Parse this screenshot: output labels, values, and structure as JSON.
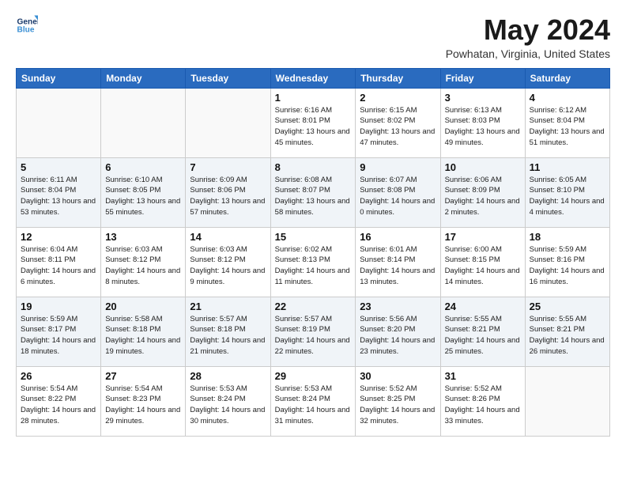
{
  "logo": {
    "line1": "General",
    "line2": "Blue"
  },
  "title": "May 2024",
  "location": "Powhatan, Virginia, United States",
  "weekdays": [
    "Sunday",
    "Monday",
    "Tuesday",
    "Wednesday",
    "Thursday",
    "Friday",
    "Saturday"
  ],
  "weeks": [
    [
      {
        "day": "",
        "sunrise": "",
        "sunset": "",
        "daylight": ""
      },
      {
        "day": "",
        "sunrise": "",
        "sunset": "",
        "daylight": ""
      },
      {
        "day": "",
        "sunrise": "",
        "sunset": "",
        "daylight": ""
      },
      {
        "day": "1",
        "sunrise": "Sunrise: 6:16 AM",
        "sunset": "Sunset: 8:01 PM",
        "daylight": "Daylight: 13 hours and 45 minutes."
      },
      {
        "day": "2",
        "sunrise": "Sunrise: 6:15 AM",
        "sunset": "Sunset: 8:02 PM",
        "daylight": "Daylight: 13 hours and 47 minutes."
      },
      {
        "day": "3",
        "sunrise": "Sunrise: 6:13 AM",
        "sunset": "Sunset: 8:03 PM",
        "daylight": "Daylight: 13 hours and 49 minutes."
      },
      {
        "day": "4",
        "sunrise": "Sunrise: 6:12 AM",
        "sunset": "Sunset: 8:04 PM",
        "daylight": "Daylight: 13 hours and 51 minutes."
      }
    ],
    [
      {
        "day": "5",
        "sunrise": "Sunrise: 6:11 AM",
        "sunset": "Sunset: 8:04 PM",
        "daylight": "Daylight: 13 hours and 53 minutes."
      },
      {
        "day": "6",
        "sunrise": "Sunrise: 6:10 AM",
        "sunset": "Sunset: 8:05 PM",
        "daylight": "Daylight: 13 hours and 55 minutes."
      },
      {
        "day": "7",
        "sunrise": "Sunrise: 6:09 AM",
        "sunset": "Sunset: 8:06 PM",
        "daylight": "Daylight: 13 hours and 57 minutes."
      },
      {
        "day": "8",
        "sunrise": "Sunrise: 6:08 AM",
        "sunset": "Sunset: 8:07 PM",
        "daylight": "Daylight: 13 hours and 58 minutes."
      },
      {
        "day": "9",
        "sunrise": "Sunrise: 6:07 AM",
        "sunset": "Sunset: 8:08 PM",
        "daylight": "Daylight: 14 hours and 0 minutes."
      },
      {
        "day": "10",
        "sunrise": "Sunrise: 6:06 AM",
        "sunset": "Sunset: 8:09 PM",
        "daylight": "Daylight: 14 hours and 2 minutes."
      },
      {
        "day": "11",
        "sunrise": "Sunrise: 6:05 AM",
        "sunset": "Sunset: 8:10 PM",
        "daylight": "Daylight: 14 hours and 4 minutes."
      }
    ],
    [
      {
        "day": "12",
        "sunrise": "Sunrise: 6:04 AM",
        "sunset": "Sunset: 8:11 PM",
        "daylight": "Daylight: 14 hours and 6 minutes."
      },
      {
        "day": "13",
        "sunrise": "Sunrise: 6:03 AM",
        "sunset": "Sunset: 8:12 PM",
        "daylight": "Daylight: 14 hours and 8 minutes."
      },
      {
        "day": "14",
        "sunrise": "Sunrise: 6:03 AM",
        "sunset": "Sunset: 8:12 PM",
        "daylight": "Daylight: 14 hours and 9 minutes."
      },
      {
        "day": "15",
        "sunrise": "Sunrise: 6:02 AM",
        "sunset": "Sunset: 8:13 PM",
        "daylight": "Daylight: 14 hours and 11 minutes."
      },
      {
        "day": "16",
        "sunrise": "Sunrise: 6:01 AM",
        "sunset": "Sunset: 8:14 PM",
        "daylight": "Daylight: 14 hours and 13 minutes."
      },
      {
        "day": "17",
        "sunrise": "Sunrise: 6:00 AM",
        "sunset": "Sunset: 8:15 PM",
        "daylight": "Daylight: 14 hours and 14 minutes."
      },
      {
        "day": "18",
        "sunrise": "Sunrise: 5:59 AM",
        "sunset": "Sunset: 8:16 PM",
        "daylight": "Daylight: 14 hours and 16 minutes."
      }
    ],
    [
      {
        "day": "19",
        "sunrise": "Sunrise: 5:59 AM",
        "sunset": "Sunset: 8:17 PM",
        "daylight": "Daylight: 14 hours and 18 minutes."
      },
      {
        "day": "20",
        "sunrise": "Sunrise: 5:58 AM",
        "sunset": "Sunset: 8:18 PM",
        "daylight": "Daylight: 14 hours and 19 minutes."
      },
      {
        "day": "21",
        "sunrise": "Sunrise: 5:57 AM",
        "sunset": "Sunset: 8:18 PM",
        "daylight": "Daylight: 14 hours and 21 minutes."
      },
      {
        "day": "22",
        "sunrise": "Sunrise: 5:57 AM",
        "sunset": "Sunset: 8:19 PM",
        "daylight": "Daylight: 14 hours and 22 minutes."
      },
      {
        "day": "23",
        "sunrise": "Sunrise: 5:56 AM",
        "sunset": "Sunset: 8:20 PM",
        "daylight": "Daylight: 14 hours and 23 minutes."
      },
      {
        "day": "24",
        "sunrise": "Sunrise: 5:55 AM",
        "sunset": "Sunset: 8:21 PM",
        "daylight": "Daylight: 14 hours and 25 minutes."
      },
      {
        "day": "25",
        "sunrise": "Sunrise: 5:55 AM",
        "sunset": "Sunset: 8:21 PM",
        "daylight": "Daylight: 14 hours and 26 minutes."
      }
    ],
    [
      {
        "day": "26",
        "sunrise": "Sunrise: 5:54 AM",
        "sunset": "Sunset: 8:22 PM",
        "daylight": "Daylight: 14 hours and 28 minutes."
      },
      {
        "day": "27",
        "sunrise": "Sunrise: 5:54 AM",
        "sunset": "Sunset: 8:23 PM",
        "daylight": "Daylight: 14 hours and 29 minutes."
      },
      {
        "day": "28",
        "sunrise": "Sunrise: 5:53 AM",
        "sunset": "Sunset: 8:24 PM",
        "daylight": "Daylight: 14 hours and 30 minutes."
      },
      {
        "day": "29",
        "sunrise": "Sunrise: 5:53 AM",
        "sunset": "Sunset: 8:24 PM",
        "daylight": "Daylight: 14 hours and 31 minutes."
      },
      {
        "day": "30",
        "sunrise": "Sunrise: 5:52 AM",
        "sunset": "Sunset: 8:25 PM",
        "daylight": "Daylight: 14 hours and 32 minutes."
      },
      {
        "day": "31",
        "sunrise": "Sunrise: 5:52 AM",
        "sunset": "Sunset: 8:26 PM",
        "daylight": "Daylight: 14 hours and 33 minutes."
      },
      {
        "day": "",
        "sunrise": "",
        "sunset": "",
        "daylight": ""
      }
    ]
  ]
}
